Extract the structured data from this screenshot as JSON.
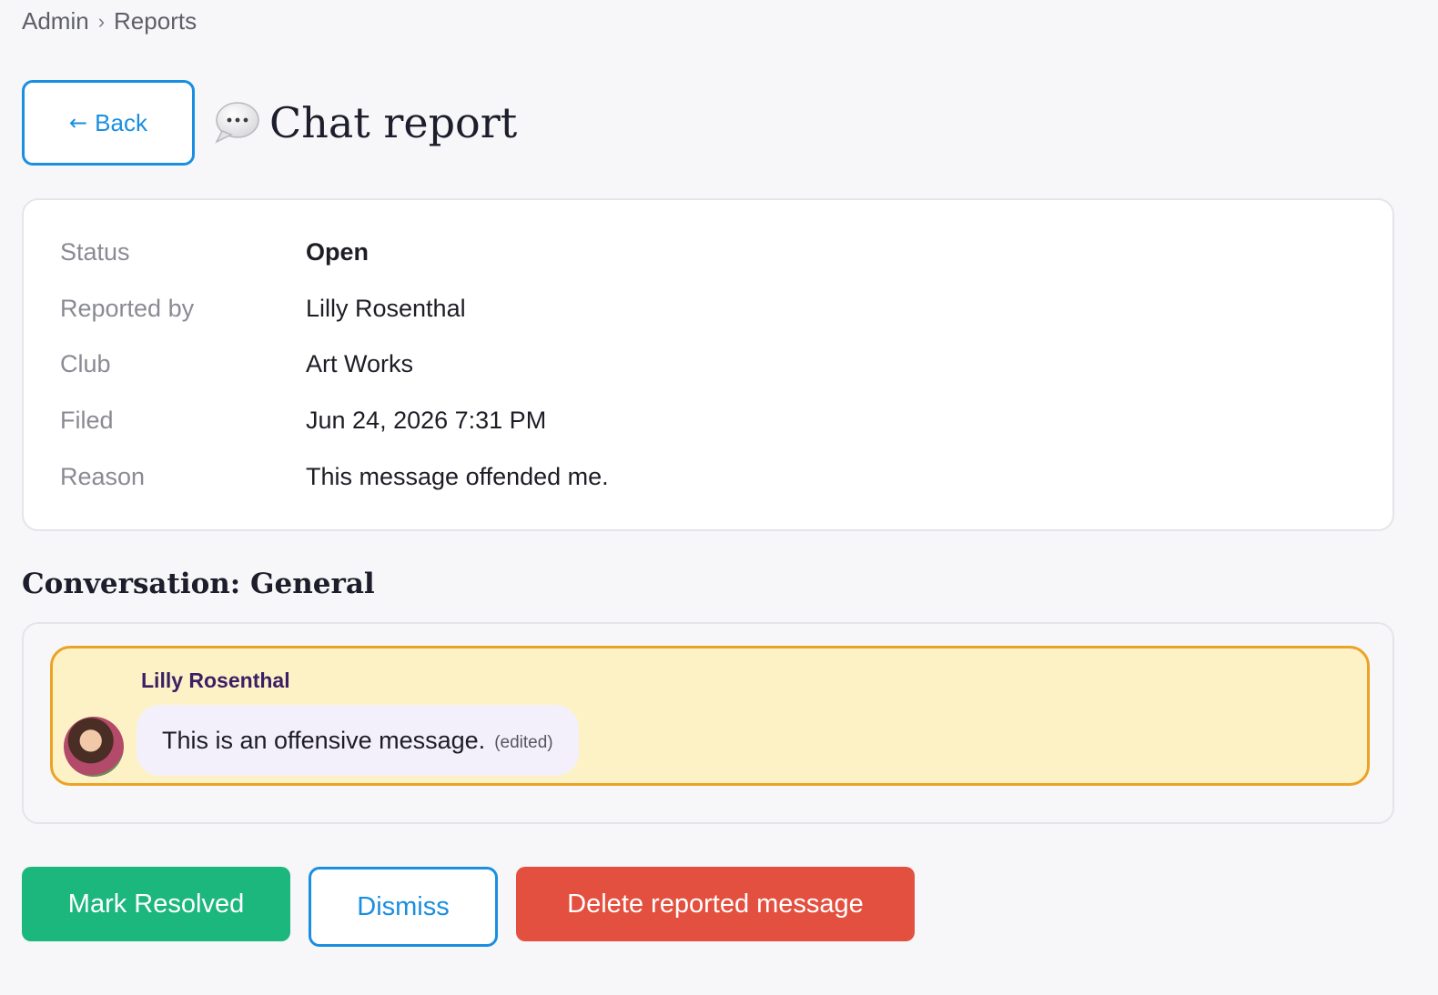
{
  "breadcrumb": {
    "root": "Admin",
    "separator": "›",
    "current": "Reports"
  },
  "header": {
    "back_arrow": "←",
    "back_label": "Back",
    "title_icon": "speech-bubble-icon",
    "title": "Chat report"
  },
  "details": {
    "status": {
      "label": "Status",
      "value": "Open"
    },
    "reported_by": {
      "label": "Reported by",
      "value": "Lilly Rosenthal"
    },
    "club": {
      "label": "Club",
      "value": "Art Works"
    },
    "filed": {
      "label": "Filed",
      "value": "Jun 24, 2026 7:31 PM"
    },
    "reason": {
      "label": "Reason",
      "value": "This message offended me."
    }
  },
  "conversation": {
    "title": "Conversation: General",
    "message": {
      "author": "Lilly Rosenthal",
      "text": "This is an offensive message.",
      "edited": "(edited)"
    }
  },
  "actions": {
    "resolve": "Mark Resolved",
    "dismiss": "Dismiss",
    "delete": "Delete reported message"
  },
  "colors": {
    "accent_blue": "#1a8ee0",
    "resolve_green": "#1bb77d",
    "delete_red": "#e4503f",
    "highlight_bg": "#fdf2c6",
    "highlight_border": "#eaa326",
    "author_purple": "#3b1f66"
  }
}
